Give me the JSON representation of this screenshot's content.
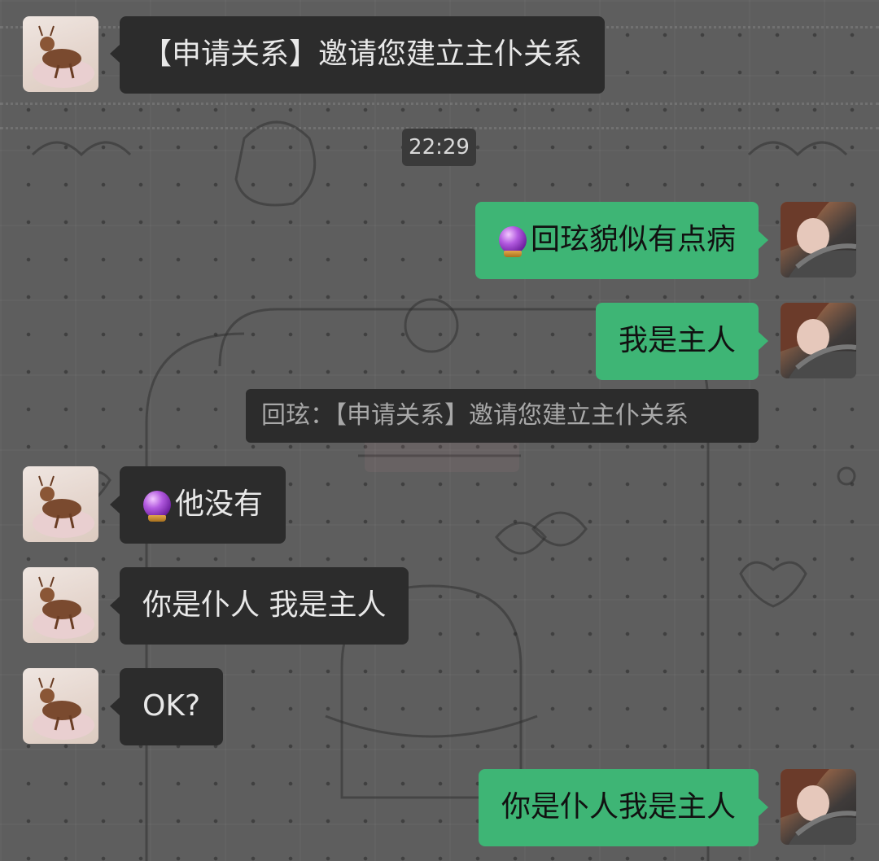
{
  "timestamp": "22:29",
  "colors": {
    "incoming_bubble": "#2c2c2c",
    "outgoing_bubble": "#3eb575",
    "background": "#5f5f5f"
  },
  "messages": [
    {
      "sender": "other",
      "avatar": "deer-avatar",
      "text": "【申请关系】邀请您建立主仆关系"
    },
    {
      "sender": "me",
      "avatar": "girl-avatar",
      "emoji": "crystal-ball-icon",
      "text": "回玹貌似有点病"
    },
    {
      "sender": "me",
      "avatar": "girl-avatar",
      "text": "我是主人",
      "quote": "回玹：【申请关系】邀请您建立主仆关系"
    },
    {
      "sender": "other",
      "avatar": "deer-avatar",
      "emoji": "crystal-ball-icon",
      "text": "他没有"
    },
    {
      "sender": "other",
      "avatar": "deer-avatar",
      "text": "你是仆人 我是主人"
    },
    {
      "sender": "other",
      "avatar": "deer-avatar",
      "text": "OK?"
    },
    {
      "sender": "me",
      "avatar": "girl-avatar",
      "text": "你是仆人我是主人"
    }
  ]
}
